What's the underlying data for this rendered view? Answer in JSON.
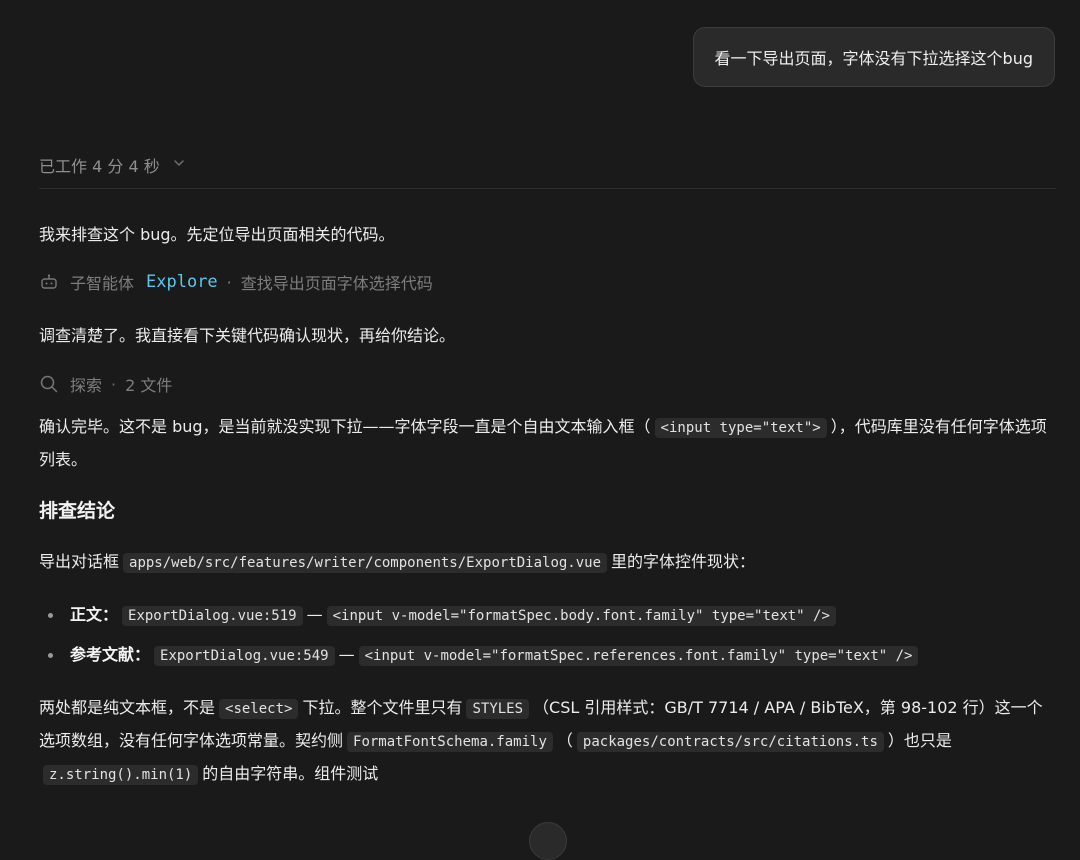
{
  "user_message": "看一下导出页面，字体没有下拉选择这个bug",
  "worked": {
    "label": "已工作 4 分 4 秒"
  },
  "assistant": {
    "intro": "我来排查这个 bug。先定位导出页面相关的代码。",
    "subagent": {
      "prefix": "子智能体",
      "name": "Explore",
      "separator": "·",
      "task": "查找导出页面字体选择代码"
    },
    "confirm_line": "调查清楚了。我直接看下关键代码确认现状，再给你结论。",
    "search_tool": {
      "label": "探索",
      "separator": "·",
      "count": "2 文件"
    },
    "finding": {
      "text_a": "确认完毕。这不是 bug，是当前就没实现下拉——字体字段一直是个自由文本输入框（",
      "code": "<input type=\"text\">",
      "text_b": "），代码库里没有任何字体选项列表。"
    },
    "section_title": "排查结论",
    "dialog_line": {
      "text_a": "导出对话框",
      "path": "apps/web/src/features/writer/components/ExportDialog.vue",
      "text_b": "里的字体控件现状："
    },
    "bullets": [
      {
        "label": "正文：",
        "ref": "ExportDialog.vue:519",
        "dash": "—",
        "code": "<input v-model=\"formatSpec.body.font.family\" type=\"text\" />"
      },
      {
        "label": "参考文献：",
        "ref": "ExportDialog.vue:549",
        "dash": "—",
        "code": "<input v-model=\"formatSpec.references.font.family\" type=\"text\" />"
      }
    ],
    "final": {
      "t1": "两处都是纯文本框，不是",
      "c1": "<select>",
      "t2": "下拉。整个文件里只有",
      "c2": "STYLES",
      "t3": "（CSL 引用样式：GB/T 7714 / APA / BibTeX，第 98-102 行）这一个选项数组，没有任何字体选项常量。契约侧",
      "c3": "FormatFontSchema.family",
      "t4": "（",
      "c4": "packages/contracts/src/citations.ts",
      "t5": "）也只是",
      "c5": "z.string().min(1)",
      "t6": "的自由字符串。组件测试"
    }
  }
}
